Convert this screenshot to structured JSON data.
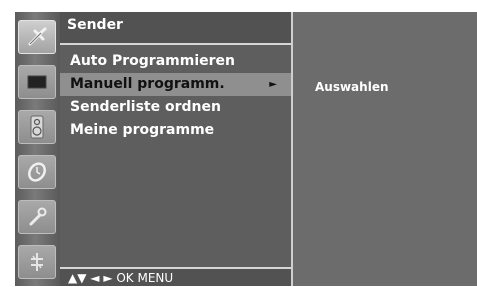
{
  "menu": {
    "title": "Sender",
    "items": [
      {
        "label": "Auto Programmieren"
      },
      {
        "label": "Manuell programm.",
        "arrow": "►"
      },
      {
        "label": "Senderliste ordnen"
      },
      {
        "label": "Meine programme"
      }
    ],
    "nav_hint": "▲▼  ◄ ►  OK  MENU"
  },
  "submenu": {
    "label": "Auswahlen"
  },
  "sidebar": {
    "icons": [
      {
        "name": "antenna-icon",
        "active": true
      },
      {
        "name": "picture-icon"
      },
      {
        "name": "speaker-icon"
      },
      {
        "name": "clock-icon"
      },
      {
        "name": "wrench-icon"
      },
      {
        "name": "input-icon"
      }
    ]
  },
  "colors": {
    "screen_bg": "#4b4b4b",
    "menu_bg": "#5e5e5e",
    "selection_bg": "#8f8f8f",
    "text": "#ffffff"
  }
}
